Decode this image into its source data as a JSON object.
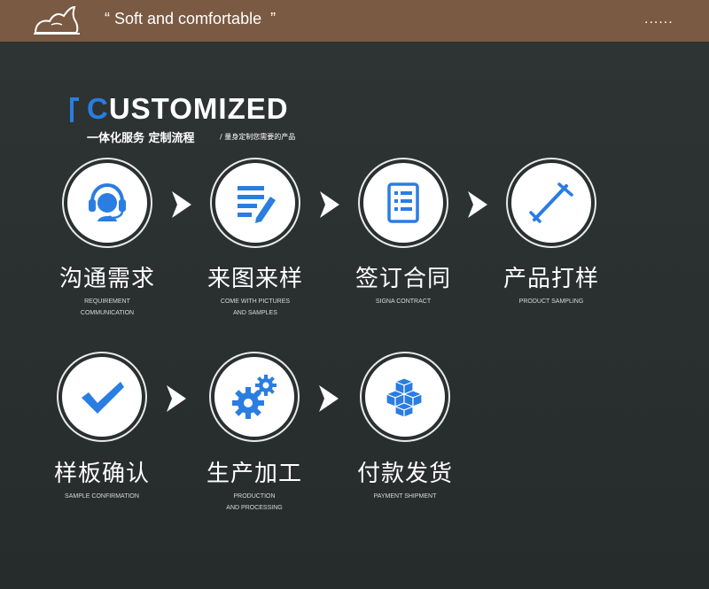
{
  "header": {
    "tagline": "“ Soft and comfortable  ”",
    "more": "......"
  },
  "title": {
    "first_letter": "C",
    "rest": "USTOMIZED"
  },
  "subtitle": "一体化服务 定制流程",
  "subnote": "/ 量身定制您需要的产品",
  "colors": {
    "topbar": "#7a5a43",
    "background": "#2a2f2f",
    "accent": "#2a7de1",
    "icon_circle": "#ffffff"
  },
  "steps": [
    {
      "label": "沟通需求",
      "sub": "REQUIREMENT\nCOMMUNICATION",
      "icon": "headset-icon"
    },
    {
      "label": "来图来样",
      "sub": "COME WITH PICTURES\nAND SAMPLES",
      "icon": "document-pen-icon"
    },
    {
      "label": "签订合同",
      "sub": "SIGNA CONTRACT",
      "icon": "contract-list-icon"
    },
    {
      "label": "产品打样",
      "sub": "PRODUCT SAMPLING",
      "icon": "ruler-tool-icon"
    },
    {
      "label": "样板确认",
      "sub": "SAMPLE CONFIRMATION",
      "icon": "checkmark-icon"
    },
    {
      "label": "生产加工",
      "sub": "PRODUCTION\nAND PROCESSING",
      "icon": "gears-icon"
    },
    {
      "label": "付款发货",
      "sub": "PAYMENT SHIPMENT",
      "icon": "boxes-icon"
    }
  ]
}
